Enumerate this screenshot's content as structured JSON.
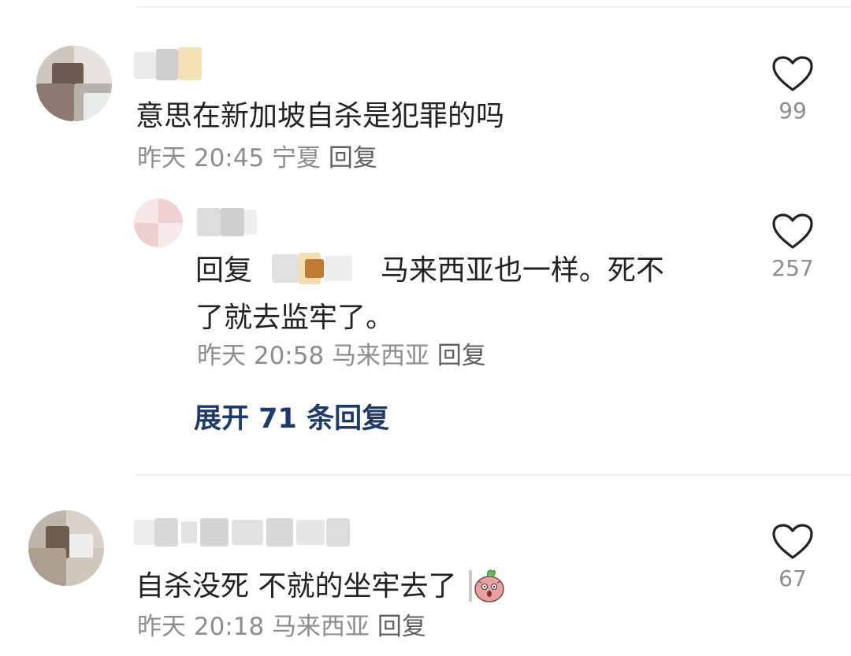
{
  "comments": [
    {
      "text": "意思在新加坡自杀是犯罪的吗",
      "time": "昨天 20:45",
      "location": "宁夏",
      "reply_label": "回复",
      "likes": "99",
      "reply": {
        "prefix": "回复",
        "text_line1": "马来西亚也一样。死不",
        "text_line2": "了就去监牢了。",
        "time": "昨天 20:58",
        "location": "马来西亚",
        "reply_label": "回复",
        "likes": "257"
      },
      "expand_label": "展开 71 条回复"
    },
    {
      "text": "自杀没死 不就的坐牢去了",
      "time": "昨天 20:18",
      "location": "马来西亚",
      "reply_label": "回复",
      "likes": "67",
      "sticker": "sweet-potato-sticker"
    }
  ],
  "icons": {
    "like": "heart-outline-icon"
  },
  "colors": {
    "text": "#222222",
    "meta": "#8d8d8d",
    "expand": "#1f3a66",
    "divider": "#efefef"
  }
}
